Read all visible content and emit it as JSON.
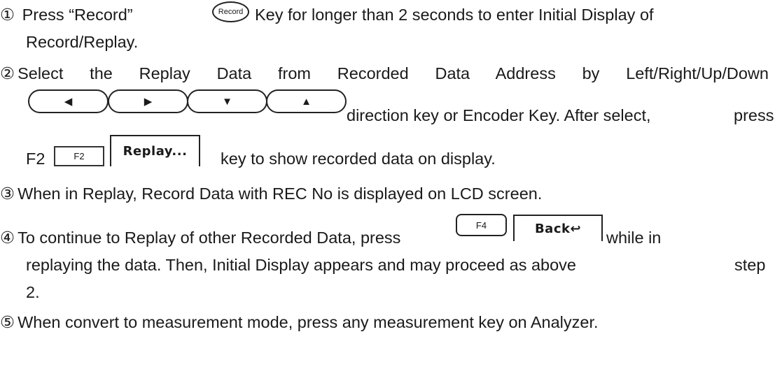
{
  "steps": [
    {
      "marker": "①",
      "text_before": "Press “Record”",
      "text_after": "Key for longer than 2 seconds to enter Initial Display of",
      "continuation": "Record/Replay."
    },
    {
      "marker": "②",
      "text": "Select the Replay Data from Recorded Data Address by Left/Right/Up/Down",
      "continuation_a": "direction key or Encoder Key. After select,",
      "continuation_a_end": "press",
      "continuation_b_prefix": "F2",
      "continuation_b": "key to show recorded data on display."
    },
    {
      "marker": "③",
      "text": "When in Replay, Record Data with REC No is displayed on LCD screen."
    },
    {
      "marker": "④",
      "text_before": "To continue to Replay of other Recorded Data, press",
      "text_after": "while in",
      "continuation_a": "replaying the data. Then, Initial Display appears and may proceed as above",
      "continuation_a_end": "step",
      "continuation_b": "2."
    },
    {
      "marker": "⑤",
      "text": "When convert to measurement mode, press any measurement key on Analyzer."
    }
  ],
  "keys": {
    "record": "Record",
    "left": "◀",
    "right": "▶",
    "down": "▼",
    "up": "▲",
    "f2": "F2",
    "replay": "Replay...",
    "f4": "F4",
    "back": "Back↩"
  }
}
